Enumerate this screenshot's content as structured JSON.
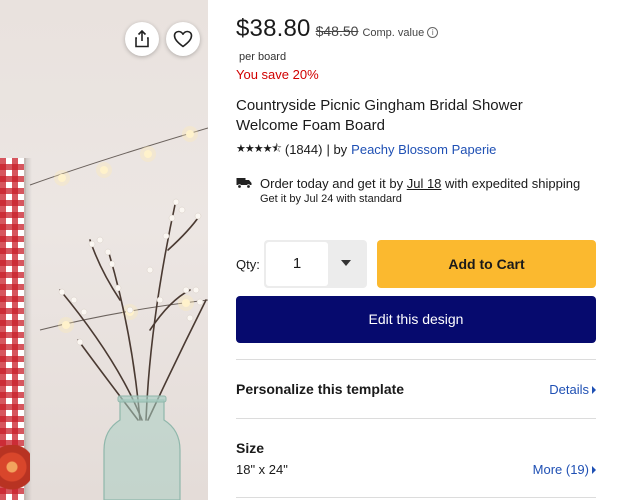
{
  "product_image": {
    "share_icon": "share-icon",
    "favorite_icon": "heart-icon"
  },
  "pricing": {
    "price": "$38.80",
    "original_price": "$48.50",
    "comp_label": "Comp. value",
    "info_icon_glyph": "i",
    "unit": "per board",
    "savings": "You save 20%"
  },
  "product": {
    "title": "Countryside Picnic Gingham Bridal Shower Welcome Foam Board",
    "stars_glyph": "★★★★⯪",
    "rating": 4.5,
    "review_count": "(1844)",
    "by_label": "| by",
    "seller": "Peachy Blossom Paperie"
  },
  "shipping": {
    "icon": "truck-icon",
    "expedited_prefix": "Order today and get it by",
    "expedited_date": "Jul 18",
    "expedited_suffix": "with expedited shipping",
    "standard": "Get it by Jul 24 with standard"
  },
  "purchase": {
    "qty_label": "Qty:",
    "qty_value": "1",
    "add_to_cart": "Add to Cart",
    "edit_design": "Edit this design"
  },
  "personalize": {
    "title": "Personalize this template",
    "details_link": "Details"
  },
  "size": {
    "title": "Size",
    "value": "18\" x 24\"",
    "more_link": "More (19)"
  },
  "colors": {
    "accent_blue": "#1f50b4",
    "cart_yellow": "#fbb92f",
    "edit_navy": "#060a6e",
    "sale_red": "#d10000"
  }
}
